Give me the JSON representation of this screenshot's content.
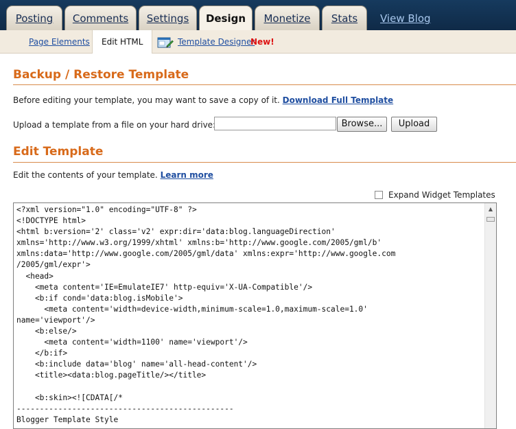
{
  "tabs": [
    {
      "label": "Posting"
    },
    {
      "label": "Comments"
    },
    {
      "label": "Settings"
    },
    {
      "label": "Design",
      "active": true
    },
    {
      "label": "Monetize"
    },
    {
      "label": "Stats"
    }
  ],
  "view_blog": "View Blog",
  "subtabs": {
    "page_elements": "Page Elements",
    "edit_html": "Edit HTML",
    "template_designer": "Template Designer",
    "new_badge": "New!"
  },
  "backup": {
    "title": "Backup / Restore Template",
    "intro": "Before editing your template, you may want to save a copy of it.",
    "download_link": "Download Full Template",
    "upload_label": "Upload a template from a file on your hard drive:",
    "browse_button": "Browse...",
    "upload_button": "Upload"
  },
  "edit": {
    "title": "Edit Template",
    "intro": "Edit the contents of your template.",
    "learn_more": "Learn more",
    "expand_widgets": "Expand Widget Templates",
    "expand_checked": false
  },
  "code_text": "<?xml version=\"1.0\" encoding=\"UTF-8\" ?>\n<!DOCTYPE html>\n<html b:version='2' class='v2' expr:dir='data:blog.languageDirection'\nxmlns='http://www.w3.org/1999/xhtml' xmlns:b='http://www.google.com/2005/gml/b'\nxmlns:data='http://www.google.com/2005/gml/data' xmlns:expr='http://www.google.com\n/2005/gml/expr'>\n  <head>\n    <meta content='IE=EmulateIE7' http-equiv='X-UA-Compatible'/>\n    <b:if cond='data:blog.isMobile'>\n      <meta content='width=device-width,minimum-scale=1.0,maximum-scale=1.0'\nname='viewport'/>\n    <b:else/>\n      <meta content='width=1100' name='viewport'/>\n    </b:if>\n    <b:include data='blog' name='all-head-content'/>\n    <title><data:blog.pageTitle/></title>\n\n    <b:skin><![CDATA[/*\n-----------------------------------------------\nBlogger Template Style",
  "icons": {
    "template_designer": "template-designer-icon",
    "scroll_up": "scroll-up-arrow-icon"
  },
  "colors": {
    "topbar": "#12304f",
    "accent_orange": "#d86a1a",
    "link_blue": "#1f4ea0",
    "new_red": "#dd1111"
  }
}
